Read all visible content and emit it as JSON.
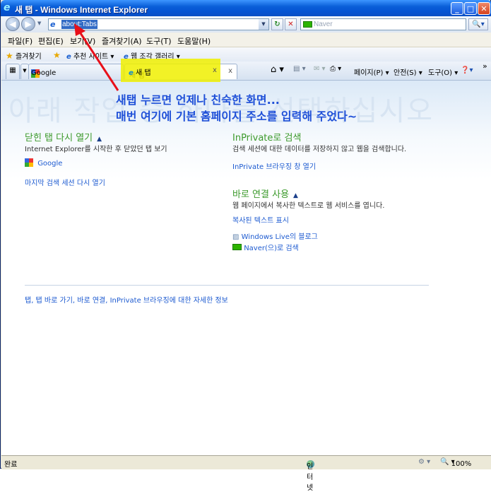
{
  "window": {
    "title": "새 탭 - Windows Internet Explorer"
  },
  "address_bar": {
    "url": "about:Tabs"
  },
  "search": {
    "placeholder": "Naver"
  },
  "menu": [
    "파일(F)",
    "편집(E)",
    "보기(V)",
    "즐겨찾기(A)",
    "도구(T)",
    "도움말(H)"
  ],
  "favorites_bar": {
    "favorites_label": "즐겨찾기",
    "suggested_sites": "추천 사이트 ▾",
    "web_slice_gallery": "웹 조각 갤러리 ▾"
  },
  "tabs": [
    {
      "label": "Google"
    },
    {
      "label": "새 탭"
    }
  ],
  "command_bar": {
    "page": "페이지(P) ▾",
    "safety": "안전(S) ▾",
    "tools": "도구(O) ▾"
  },
  "content": {
    "heading": "아래 작업 중 하나를 선택하십시오",
    "reopen": {
      "title": "닫힌 탭 다시 열기",
      "desc": "Internet Explorer를 시작한 후 닫았던 탭 보기",
      "google": "Google",
      "reopen_session": "마지막 검색 세션 다시 열기"
    },
    "inprivate": {
      "title": "InPrivate로 검색",
      "desc": "검색 세션에 대한 데이터를 저장하지 않고 웹을 검색합니다.",
      "open": "InPrivate 브라우징 창 열기"
    },
    "accelerators": {
      "title": "바로 연결 사용",
      "desc": "웹 페이지에서 복사한 텍스트로 웹 서비스를 엽니다.",
      "show_copied": "복사된 텍스트 표시",
      "blog": "Windows Live의 블로그",
      "naver": "Naver(으)로 검색"
    },
    "footer_link": "탭, 탭 바로 가기, 바로 연결, InPrivate 브라우징에 대한 자세한 정보"
  },
  "annotation": {
    "line1": "새탭 누르면 언제나 친숙한 화면...",
    "line2": "매번 여기에 기본 홈페이지 주소를 입력해 주었다~"
  },
  "status": {
    "left": "완료",
    "zone": "인터넷",
    "zoom": "100%"
  },
  "colors": {
    "annotation_text": "#1f50d8",
    "annotation_arrow": "#e8101a",
    "highlight": "#f0f000",
    "section_heading": "#3c9a2c",
    "link": "#1c5ad0"
  }
}
